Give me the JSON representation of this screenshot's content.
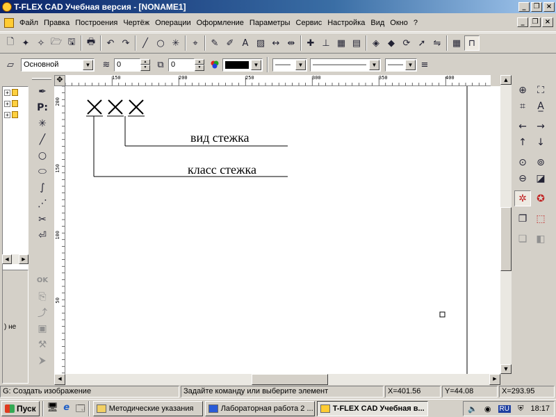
{
  "window": {
    "title": "T-FLEX CAD Учебная версия - [NONAME1]",
    "min_glyph": "_",
    "max_glyph": "❐",
    "close_glyph": "×"
  },
  "menu": [
    {
      "label": "Файл"
    },
    {
      "label": "Правка"
    },
    {
      "label": "Построения"
    },
    {
      "label": "Чертёж"
    },
    {
      "label": "Операции"
    },
    {
      "label": "Оформление"
    },
    {
      "label": "Параметры"
    },
    {
      "label": "Сервис"
    },
    {
      "label": "Настройка"
    },
    {
      "label": "Вид"
    },
    {
      "label": "Окно"
    },
    {
      "label": "?"
    }
  ],
  "toolbar_main": {
    "new": "🗋",
    "new_from": "✦",
    "new_3d": "✧",
    "open": "🗁",
    "save": "🖫",
    "print": "🖶",
    "undo": "↶",
    "redo": "↷",
    "line": "╱",
    "circle": "○",
    "node": "✳",
    "snap": "⌖",
    "pen": "✎",
    "pen2": "✐",
    "text": "A",
    "hatch": "▨",
    "dim": "↔",
    "dim2": "⇹",
    "cross": "✚",
    "point": "⊥",
    "grid": "▦",
    "layers": "▤",
    "view3d": "◈",
    "solid": "◆",
    "rotate": "⟳",
    "move": "➚",
    "mirror": "⇋",
    "calc": "▦",
    "magnet": "⊓"
  },
  "toolbar_props": {
    "layer_value": "Основной",
    "level_value": "0",
    "priority_value": "0",
    "line_style": "——",
    "line_thickness": "———————",
    "line_end": "——"
  },
  "tree": {
    "rows": [
      "+",
      "+",
      "+"
    ],
    "status_text": ") не"
  },
  "vtools_top": [
    {
      "name": "pen-icon",
      "glyph": "✒"
    },
    {
      "name": "param-icon",
      "glyph": "P:"
    },
    {
      "name": "node-icon",
      "glyph": "✳"
    },
    {
      "name": "line-icon",
      "glyph": "╱"
    },
    {
      "name": "circle-icon",
      "glyph": "○"
    },
    {
      "name": "ellipse-icon",
      "glyph": "⬭"
    },
    {
      "name": "spline-icon",
      "glyph": "∫"
    },
    {
      "name": "dash-icon",
      "glyph": "⋰"
    },
    {
      "name": "scissors-icon",
      "glyph": "✂"
    },
    {
      "name": "exit-icon",
      "glyph": "⏎"
    }
  ],
  "vtools_bottom": [
    {
      "name": "ok-icon",
      "glyph": "OK"
    },
    {
      "name": "copy-icon",
      "glyph": "⎘"
    },
    {
      "name": "move-icon",
      "glyph": "⤴"
    },
    {
      "name": "frame-icon",
      "glyph": "▣"
    },
    {
      "name": "brush-icon",
      "glyph": "⚒"
    },
    {
      "name": "cursor-icon",
      "glyph": "⮞"
    }
  ],
  "ruler": {
    "h_labels": [
      "150",
      "200",
      "250",
      "300",
      "350",
      "400"
    ],
    "v_labels": [
      "200",
      "150",
      "100",
      "50"
    ],
    "corner_glyph": "✥"
  },
  "drawing": {
    "symbols": [
      "X",
      "X",
      "X"
    ],
    "label_type": "вид стежка",
    "label_class": "класс стежка"
  },
  "rtools": [
    {
      "name": "zoom-in-icon",
      "glyph": "⊕"
    },
    {
      "name": "zoom-window-icon",
      "glyph": "⛶"
    },
    {
      "name": "zoom-all-icon",
      "glyph": "⌗"
    },
    {
      "name": "text-scale-icon",
      "glyph": "A̲"
    },
    {
      "name": "pan-left-icon",
      "glyph": "←"
    },
    {
      "name": "pan-right-icon",
      "glyph": "→"
    },
    {
      "name": "pan-up-icon",
      "glyph": "↑"
    },
    {
      "name": "pan-down-icon",
      "glyph": "↓"
    },
    {
      "name": "zoom-prev-icon",
      "glyph": "⊙"
    },
    {
      "name": "zoom-next-icon",
      "glyph": "⊚"
    },
    {
      "name": "zoom-out-icon",
      "glyph": "⊖"
    },
    {
      "name": "redraw-icon",
      "glyph": "◪"
    },
    {
      "name": "snap-toggle-icon",
      "glyph": "✲"
    },
    {
      "name": "marker-icon",
      "glyph": "✪"
    },
    {
      "name": "pages-icon",
      "glyph": "❐"
    },
    {
      "name": "cube-icon",
      "glyph": "⬚"
    },
    {
      "name": "view-copy-icon",
      "glyph": "❏"
    },
    {
      "name": "view-3d-icon",
      "glyph": "◧"
    }
  ],
  "status": {
    "command": "G: Создать изображение",
    "prompt": "Задайте команду или выберите элемент",
    "x": "X=401.56",
    "y": "Y=44.08",
    "x2": "X=293.95"
  },
  "taskbar": {
    "start": "Пуск",
    "tasks": [
      {
        "label": "Методические указания",
        "active": false
      },
      {
        "label": "Лабораторная работа 2 ...",
        "active": false
      },
      {
        "label": "T-FLEX CAD Учебная в...",
        "active": true
      }
    ],
    "lang": "RU",
    "clock": "18:17",
    "quick": [
      "🖥",
      "e",
      "🗔"
    ]
  },
  "colors": {
    "titlebar_start": "#0a246a",
    "titlebar_end": "#a6caf0",
    "face": "#d4d0c8",
    "canvas": "#ffffff"
  }
}
